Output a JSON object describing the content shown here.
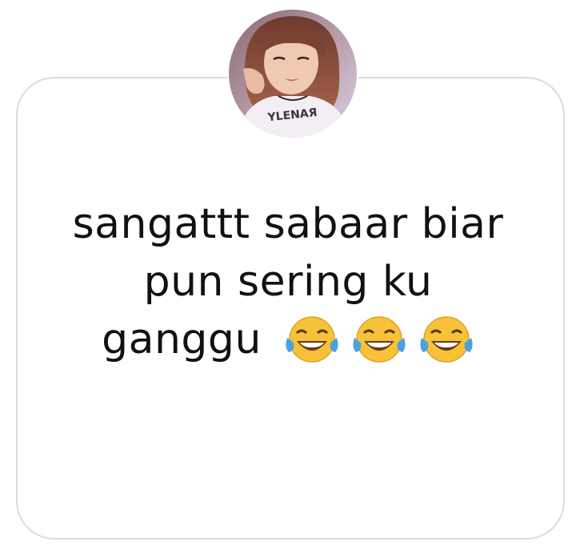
{
  "message": {
    "line1": "sangattt sabaar biar",
    "line2": "pun sering ku",
    "line3": "ganggu",
    "emojis": [
      "face-with-tears-of-joy-icon",
      "face-with-tears-of-joy-icon",
      "face-with-tears-of-joy-icon"
    ]
  },
  "avatar": {
    "shirt_text": "YLENAЯ"
  },
  "colors": {
    "card_border": "#dcdcdc",
    "text": "#111111",
    "emoji_face": "#f7c23a",
    "tear": "#4aa3e0"
  }
}
